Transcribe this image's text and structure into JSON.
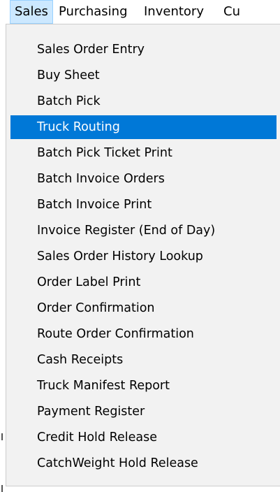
{
  "menubar": {
    "items": [
      "Sales",
      "Purchasing",
      "Inventory",
      "Cu"
    ],
    "active_index": 0
  },
  "menu": {
    "selected_index": 3,
    "items": [
      "Sales Order Entry",
      "Buy Sheet",
      "Batch Pick",
      "Truck Routing",
      "Batch Pick Ticket Print",
      "Batch Invoice Orders",
      "Batch Invoice Print",
      "Invoice Register (End of Day)",
      "Sales Order History Lookup",
      "Order Label Print",
      "Order Confirmation",
      "Route Order Confirmation",
      "Cash Receipts",
      "Truck Manifest Report",
      "Payment Register",
      "Credit Hold Release",
      "CatchWeight Hold Release"
    ]
  },
  "colors": {
    "selection_bg": "#0078d7",
    "selection_text": "#ffffff",
    "menu_bg": "#f2f2f2",
    "menubar_active_bg": "#cce8ff",
    "menubar_active_border": "#99d1ff"
  }
}
